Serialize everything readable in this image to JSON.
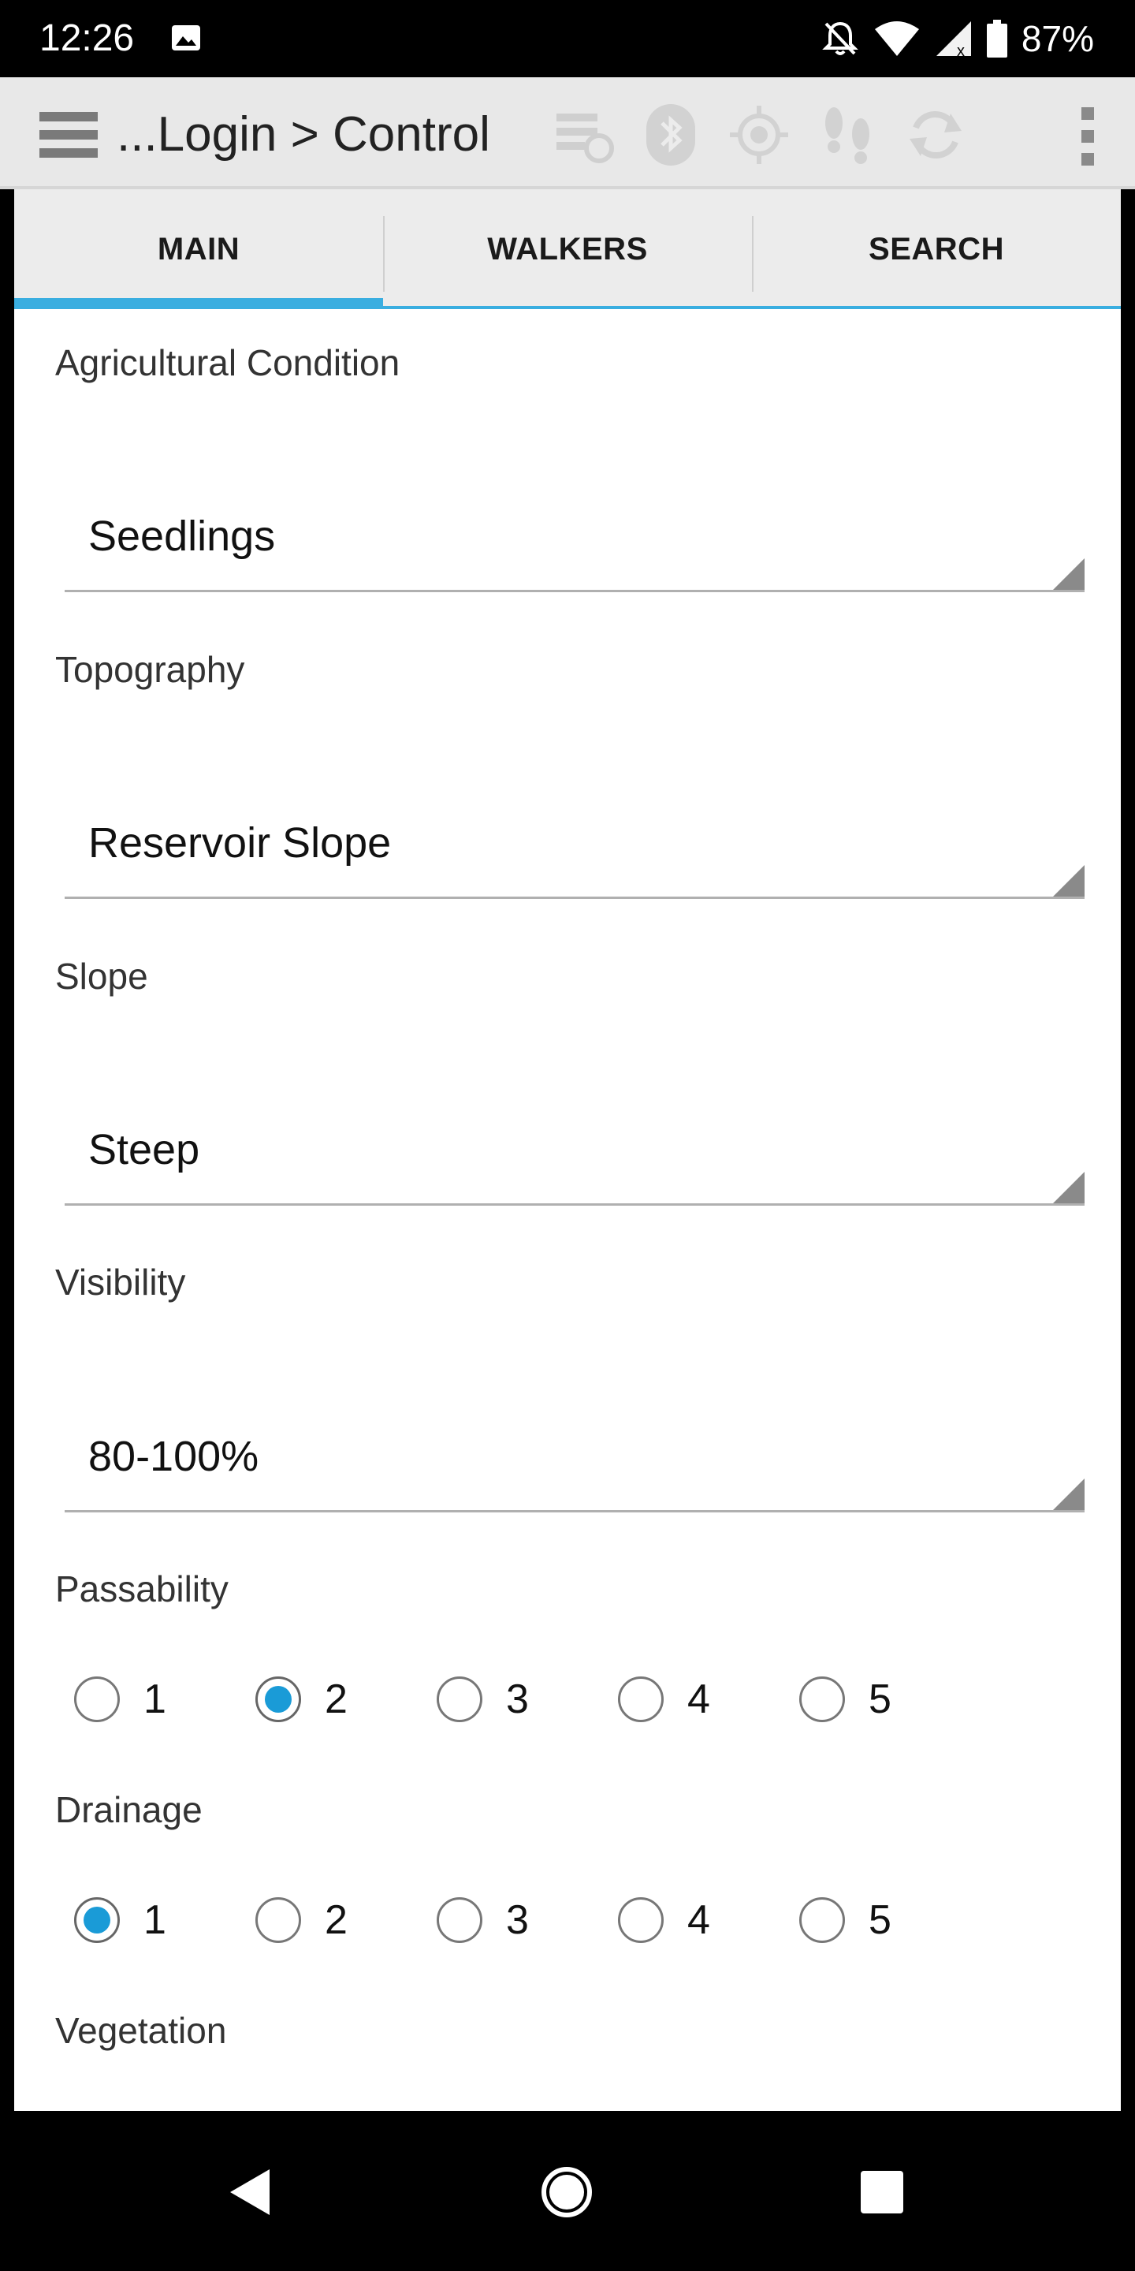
{
  "status_bar": {
    "time": "12:26",
    "battery": "87%",
    "icons": [
      "photo-icon",
      "notifications-off-icon",
      "wifi-icon",
      "signal-icon",
      "battery-icon"
    ]
  },
  "app_bar": {
    "title": "...Login > Control",
    "actions": [
      "sync-settings-icon",
      "bluetooth-icon",
      "gps-target-icon",
      "footsteps-icon",
      "refresh-icon",
      "overflow-menu-icon"
    ],
    "action_color": "#c8c8c8"
  },
  "tabs": [
    {
      "label": "MAIN",
      "active": true
    },
    {
      "label": "WALKERS",
      "active": false
    },
    {
      "label": "SEARCH",
      "active": false
    }
  ],
  "accent_color": "#3aaee0",
  "form": {
    "agricultural_condition": {
      "label": "Agricultural Condition",
      "value": "Seedlings"
    },
    "topography": {
      "label": "Topography",
      "value": "Reservoir Slope"
    },
    "slope": {
      "label": "Slope",
      "value": "Steep"
    },
    "visibility": {
      "label": "Visibility",
      "value": "80-100%"
    },
    "passability": {
      "label": "Passability",
      "options": [
        "1",
        "2",
        "3",
        "4",
        "5"
      ],
      "selected": "2"
    },
    "drainage": {
      "label": "Drainage",
      "options": [
        "1",
        "2",
        "3",
        "4",
        "5"
      ],
      "selected": "1"
    },
    "vegetation": {
      "label": "Vegetation"
    }
  },
  "nav_bar": {
    "buttons": [
      "back-icon",
      "home-icon",
      "recents-icon"
    ]
  }
}
